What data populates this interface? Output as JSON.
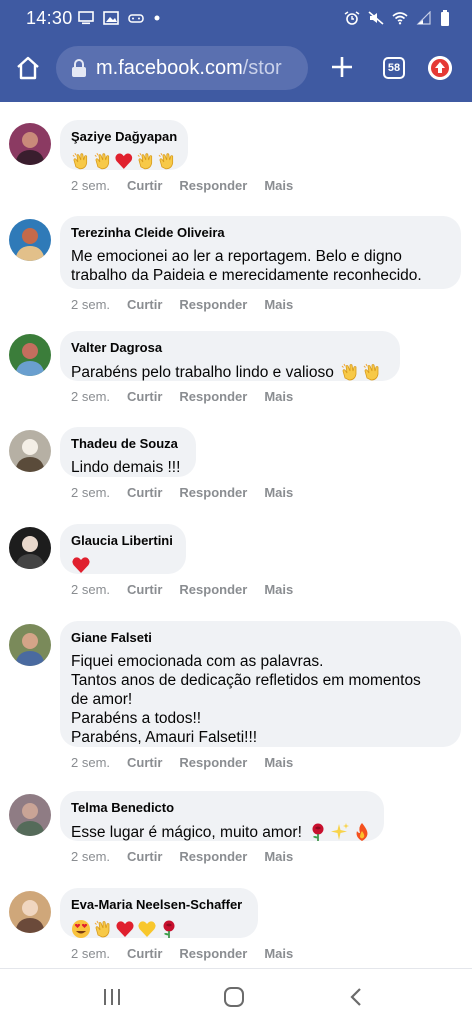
{
  "status_bar": {
    "time": "14:30",
    "left_icons": [
      "monitor-icon",
      "image-icon",
      "game-icon",
      "dot-icon"
    ],
    "right_icons": [
      "alarm-icon",
      "mute-icon",
      "wifi-icon",
      "signal-icon",
      "battery-icon"
    ]
  },
  "browser": {
    "url_main": "m.facebook.com",
    "url_rest": "/stor",
    "tab_count": "58",
    "accent": "#3f5aa2"
  },
  "comments": [
    {
      "name": "Şaziye Dağyapan",
      "text": "",
      "emojis": [
        "clap",
        "clap",
        "heart",
        "clap",
        "clap"
      ],
      "time": "2 sem.",
      "like": "Curtir",
      "reply": "Responder",
      "more": "Mais"
    },
    {
      "name": "Terezinha Cleide Oliveira",
      "text": "Me emocionei ao ler a reportagem. Belo e digno\ntrabalho da Paideia e merecidamente reconhecido.",
      "emojis": [],
      "time": "2 sem.",
      "like": "Curtir",
      "reply": "Responder",
      "more": "Mais"
    },
    {
      "name": "Valter Dagrosa",
      "text": "Parabéns pelo trabalho lindo e valioso",
      "emojis": [
        "clap",
        "clap"
      ],
      "time": "2 sem.",
      "like": "Curtir",
      "reply": "Responder",
      "more": "Mais"
    },
    {
      "name": "Thadeu de Souza",
      "text": "Lindo demais !!!",
      "emojis": [],
      "time": "2 sem.",
      "like": "Curtir",
      "reply": "Responder",
      "more": "Mais"
    },
    {
      "name": "Glaucia Libertini",
      "text": "",
      "emojis": [
        "heart"
      ],
      "time": "2 sem.",
      "like": "Curtir",
      "reply": "Responder",
      "more": "Mais"
    },
    {
      "name": "Giane Falseti",
      "text": "Fiquei emocionada com as palavras.\nTantos anos de dedicação refletidos em momentos\nde amor!\nParabéns a todos!!\nParabéns, Amauri Falseti!!!",
      "emojis": [],
      "time": "2 sem.",
      "like": "Curtir",
      "reply": "Responder",
      "more": "Mais"
    },
    {
      "name": "Telma Benedicto",
      "text": "Esse lugar é mágico, muito amor!",
      "emojis": [
        "rose",
        "sparkles",
        "fire"
      ],
      "time": "2 sem.",
      "like": "Curtir",
      "reply": "Responder",
      "more": "Mais"
    },
    {
      "name": "Eva-Maria Neelsen-Schaffer",
      "text": "",
      "emojis": [
        "heart-eyes",
        "clap",
        "heart",
        "yellow-heart",
        "rose"
      ],
      "time": "2 sem.",
      "like": "Curtir",
      "reply": "Responder",
      "more": "Mais"
    }
  ],
  "nav": [
    "recent-apps-icon",
    "home-icon",
    "back-icon"
  ]
}
